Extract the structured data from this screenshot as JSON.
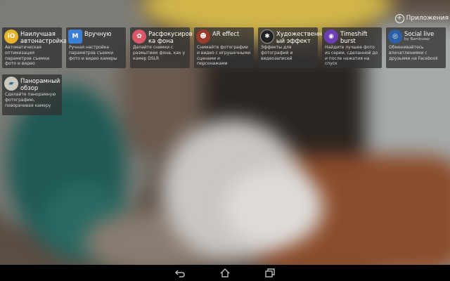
{
  "header": {
    "apps_label": "Приложения"
  },
  "tiles": [
    {
      "title": "Наилучшая автонастройка",
      "desc": "Автоматическая оптимизация параметров съемки фото и видео",
      "icon": "superior-auto-icon",
      "icon_text": "iO",
      "icon_color": "#e8b22b"
    },
    {
      "title": "Вручную",
      "desc": "Ручная настройка параметров съемки фото и видео камеры",
      "icon": "manual-mode-icon",
      "icon_text": "M",
      "icon_color": "#3d7ed6"
    },
    {
      "title": "Расфокусиров ка фона",
      "desc": "Делайте снимки с размытием фона, как у камер DSLR",
      "icon": "background-defocus-icon",
      "icon_text": "✿",
      "icon_color": "#d8586a"
    },
    {
      "title": "AR effect",
      "desc": "Снимайте фотографии и видео с игрушечными сценами и персонажами",
      "icon": "ar-effect-icon",
      "icon_text": "☻",
      "icon_color": "#9b3b2e"
    },
    {
      "title": "Художественн ый эффект",
      "desc": "Эффекты для фотографий и видеозаписей",
      "icon": "creative-effect-icon",
      "icon_text": "✱",
      "icon_color": "#222222"
    },
    {
      "title": "Timeshift burst",
      "desc": "Найдите лучшее фото из серии, сделанной до и после нажатия на спуск",
      "icon": "timeshift-burst-icon",
      "icon_text": "◉",
      "icon_color": "#6d3fb4"
    },
    {
      "title": "Social live",
      "subtitle": "by Bambuser",
      "desc": "Обменивайтесь впечатлениями с друзьями на Facebook",
      "icon": "social-live-icon",
      "icon_text": "◎",
      "icon_color": "#2d5fa8"
    },
    {
      "title": "Панорамный обзор",
      "desc": "Сделайте панорамную фотографию, поворачивая камеру",
      "icon": "sweep-panorama-icon",
      "icon_text": "▰",
      "icon_color": "#c9c9c0"
    }
  ],
  "navbar": {
    "back_icon": "back-icon",
    "home_icon": "home-icon",
    "recents_icon": "recent-apps-icon"
  }
}
